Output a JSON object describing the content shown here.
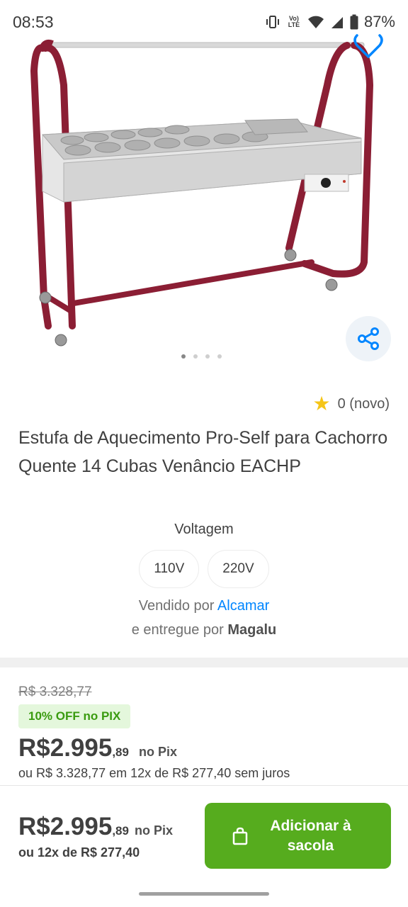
{
  "status_bar": {
    "time": "08:53",
    "lte_label": "Vo) LTE",
    "battery": "87%"
  },
  "product": {
    "rating": "0 (novo)",
    "title": "Estufa de Aquecimento Pro-Self para Cachorro Quente 14 Cubas Venâncio EACHP",
    "carousel_pages": 4,
    "carousel_current": 1
  },
  "voltage": {
    "label": "Voltagem",
    "options": [
      "110V",
      "220V"
    ]
  },
  "seller": {
    "sold_by_prefix": "Vendido por ",
    "sold_by_name": "Alcamar",
    "delivered_by_prefix": "e entregue por ",
    "delivered_by_name": "Magalu"
  },
  "pricing": {
    "old_price": "R$ 3.328,77",
    "discount_badge": "10% OFF no PIX",
    "price_main": "R$2.995",
    "price_cents": ",89",
    "price_method": "no Pix",
    "installments": "ou R$ 3.328,77 em 12x de R$ 277,40 sem juros"
  },
  "bottom_bar": {
    "price_main": "R$2.995",
    "price_cents": ",89",
    "price_method": "no Pix",
    "installments": "ou 12x de R$ 277,40",
    "add_button_label": "Adicionar à sacola"
  },
  "icons": {
    "favorite": "heart-icon",
    "share": "share-icon",
    "rating": "star-icon",
    "bag": "shopping-bag-icon"
  },
  "colors": {
    "accent_blue": "#0086ff",
    "cta_green": "#56ac1e",
    "badge_green_text": "#3a9b10",
    "badge_green_bg": "#e4f7dc",
    "frame_burgundy": "#8b1e34"
  }
}
